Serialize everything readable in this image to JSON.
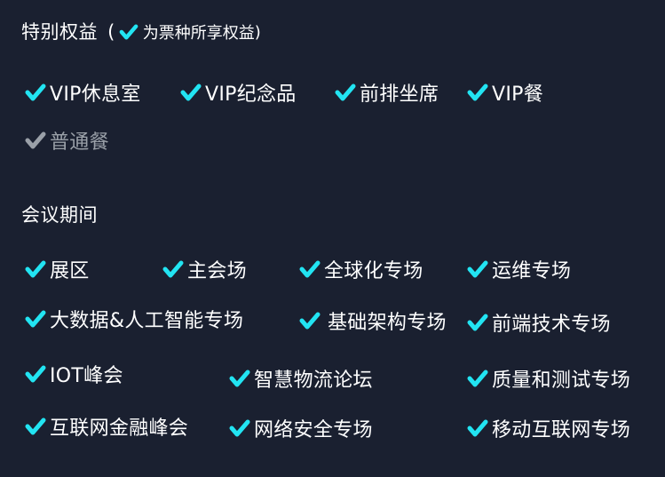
{
  "colors": {
    "check": "#22e4f2",
    "check_dim": "#9aa0a8",
    "background": "#1a2030"
  },
  "header": {
    "title": "特别权益",
    "paren_open": "(",
    "legend_text": "为票种所享权益",
    "paren_close": ")"
  },
  "privileges": [
    {
      "label": "VIP休息室",
      "included": true
    },
    {
      "label": "VIP纪念品",
      "included": true
    },
    {
      "label": "前排坐席",
      "included": true
    },
    {
      "label": "VIP餐",
      "included": true
    },
    {
      "label": "普通餐",
      "included": false
    }
  ],
  "sessions_title": "会议期间",
  "sessions": [
    {
      "label": "展区",
      "included": true
    },
    {
      "label": "主会场",
      "included": true
    },
    {
      "label": "全球化专场",
      "included": true
    },
    {
      "label": "运维专场",
      "included": true
    },
    {
      "label": "大数据&人工智能专场",
      "included": true
    },
    {
      "label": "基础架构专场",
      "included": true
    },
    {
      "label": "前端技术专场",
      "included": true
    },
    {
      "label": "IOT峰会",
      "included": true
    },
    {
      "label": "智慧物流论坛",
      "included": true
    },
    {
      "label": "质量和测试专场",
      "included": true
    },
    {
      "label": "互联网金融峰会",
      "included": true
    },
    {
      "label": "网络安全专场",
      "included": true
    },
    {
      "label": "移动互联网专场",
      "included": true
    }
  ]
}
